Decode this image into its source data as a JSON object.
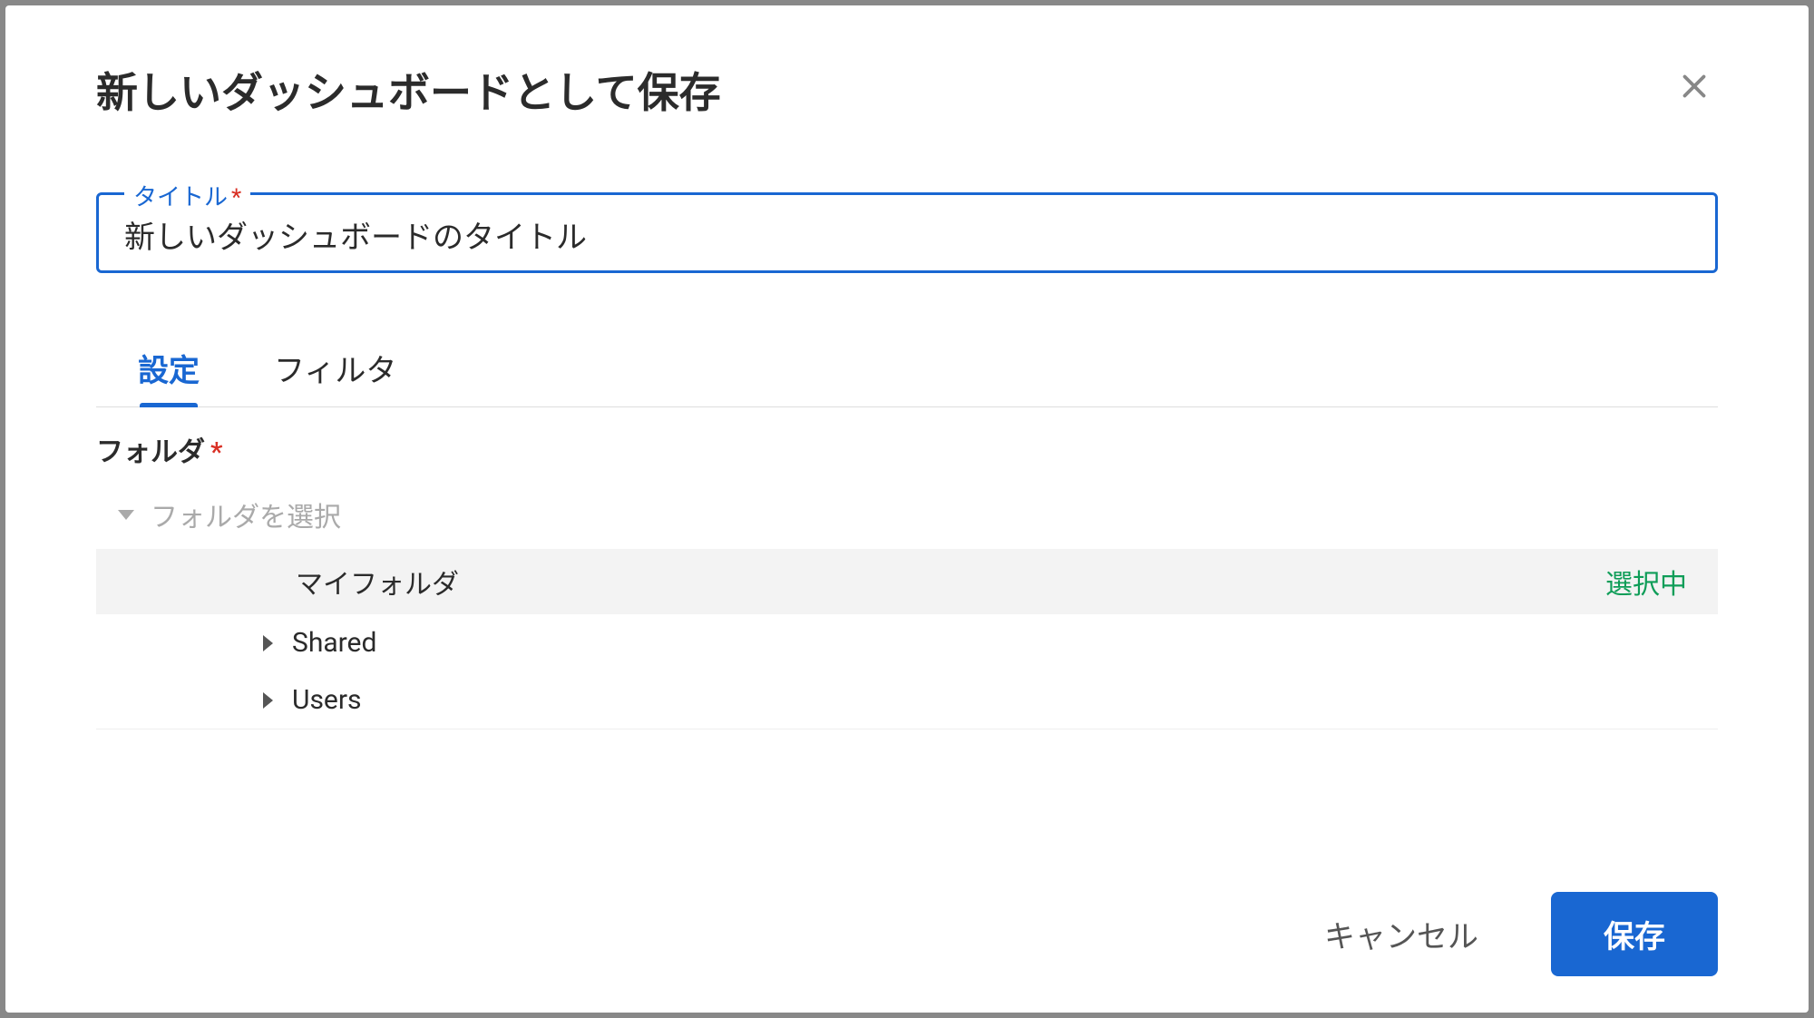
{
  "modal": {
    "title": "新しいダッシュボードとして保存",
    "title_field": {
      "label": "タイトル",
      "required_mark": "*",
      "value": "新しいダッシュボードのタイトル"
    },
    "tabs": [
      {
        "label": "設定",
        "active": true
      },
      {
        "label": "フィルタ",
        "active": false
      }
    ],
    "folder_section": {
      "label": "フォルダ",
      "required_mark": "*",
      "select_placeholder": "フォルダを選択",
      "items": [
        {
          "label": "マイフォルダ",
          "selected": true,
          "selected_badge": "選択中",
          "expandable": false
        },
        {
          "label": "Shared",
          "selected": false,
          "expandable": true
        },
        {
          "label": "Users",
          "selected": false,
          "expandable": true
        }
      ]
    },
    "footer": {
      "cancel_label": "キャンセル",
      "save_label": "保存"
    }
  }
}
